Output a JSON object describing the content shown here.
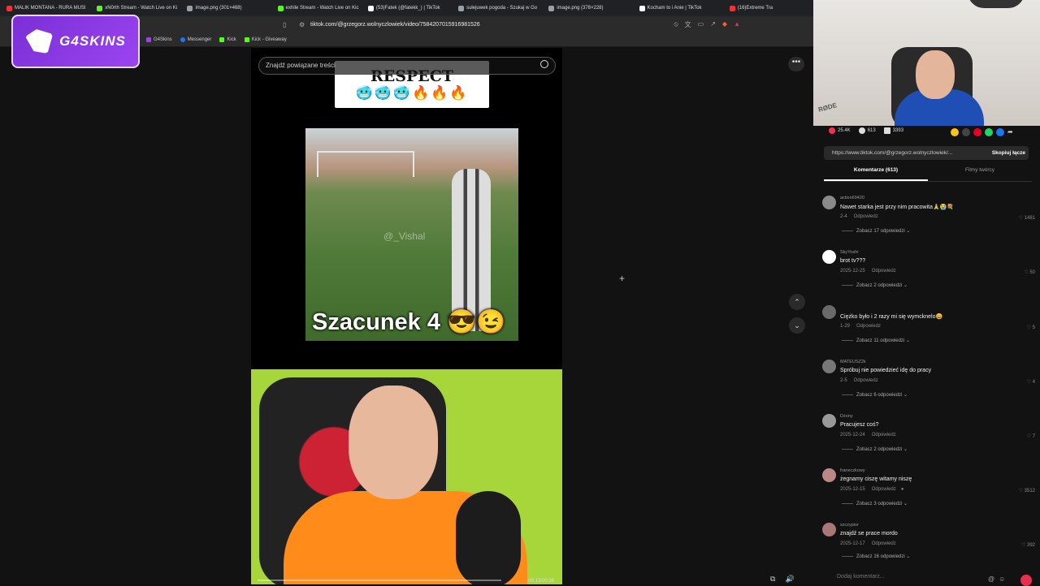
{
  "tabs": [
    {
      "label": "MALIK MONTANA - RURA MUSI",
      "color": "#ff2d2d"
    },
    {
      "label": "xN0rth Stream - Watch Live on Ki",
      "color": "#53fc18"
    },
    {
      "label": "image.png (301×468)",
      "color": "#9aa0a6"
    },
    {
      "label": "exhile Stream - Watch Live on Kic",
      "color": "#53fc18"
    },
    {
      "label": "(53)Fatek (@fatekk_) | TikTok",
      "color": "#ffffff"
    },
    {
      "label": "sułejuwek pogoda - Szukaj w Go",
      "color": "#9aa0a6"
    },
    {
      "label": "image.png (378×228)",
      "color": "#9aa0a6"
    },
    {
      "label": "Kocham to i Anie | TikTok",
      "color": "#ffffff"
    },
    {
      "label": "(16)Extreme Tra",
      "color": "#ff2d2d"
    }
  ],
  "address_bar": {
    "url": "tiktok.com/@grzegorz.wolnyczlowiek/video/7584207015916981526"
  },
  "bookmarks": [
    {
      "label": "G4Skins",
      "color": "#9a44f0"
    },
    {
      "label": "Messenger",
      "color": "#1877f2"
    },
    {
      "label": "Kick",
      "color": "#53fc18"
    },
    {
      "label": "Kick - Giveaway",
      "color": "#53fc18"
    }
  ],
  "overlay_logo": {
    "text": "G4SKINS"
  },
  "search": {
    "placeholder": "Znajdź powiązane treści"
  },
  "video": {
    "respect_text": "RESPECT",
    "respect_emoji": "🥶🥶🥶🔥🔥🔥",
    "watermark": "@_Vishal",
    "caption": "Szacunek 4 😎😉",
    "time": "00:13/00:38"
  },
  "stats": {
    "likes": "25.4K",
    "comments": "613",
    "saves": "3393"
  },
  "link": {
    "url": "https://www.tiktok.com/@grzegorz.wolnyczlowiek/...",
    "copy_label": "Skopiuj łącze"
  },
  "comment_tabs": {
    "comments": "Komentarze (613)",
    "creator_videos": "Filmy twórcy"
  },
  "comments": [
    {
      "user": "action69420",
      "text": "Nawet starka jest przy nim pracowita🙏😭💐",
      "date": "2-4",
      "reply": "Odpowiedz",
      "likes": "1481",
      "more": "Zobacz 17 odpowiedzi"
    },
    {
      "user": "SkyYoshi",
      "text": "brot tv???",
      "date": "2025-12-25",
      "reply": "Odpowiedz",
      "likes": "50",
      "more": "Zobacz 2 odpowiedzi"
    },
    {
      "user": "",
      "text": "Ciężko było i 2 razy mi się wymcknelo😀",
      "date": "1-29",
      "reply": "Odpowiedz",
      "likes": "5",
      "more": "Zobacz 11 odpowiedzi"
    },
    {
      "user": "MATEUSZ2k",
      "text": "Spróbuj nie powiedzieć idę do pracy",
      "date": "2-5",
      "reply": "Odpowiedz",
      "likes": "4",
      "more": "Zobacz 6 odpowiedzi"
    },
    {
      "user": "Dżony",
      "text": "Pracujesz coś?",
      "date": "2025-12-24",
      "reply": "Odpowiedz",
      "likes": "7",
      "more": "Zobacz 2 odpowiedzi"
    },
    {
      "user": "franeczkowy",
      "text": "żegnamy ciszę witamy niszę",
      "date": "2025-12-15",
      "reply": "Odpowiedz",
      "likes": "3512",
      "more": "Zobacz 3 odpowiedzi"
    },
    {
      "user": "szczypior",
      "text": "znajdź se prace mordo",
      "date": "2025-12-17",
      "reply": "Odpowiedz",
      "likes": "392",
      "more": "Zobacz 16 odpowiedzi"
    }
  ],
  "add_comment": {
    "placeholder": "Dodaj komentarz..."
  },
  "rode_label": "RØDE"
}
